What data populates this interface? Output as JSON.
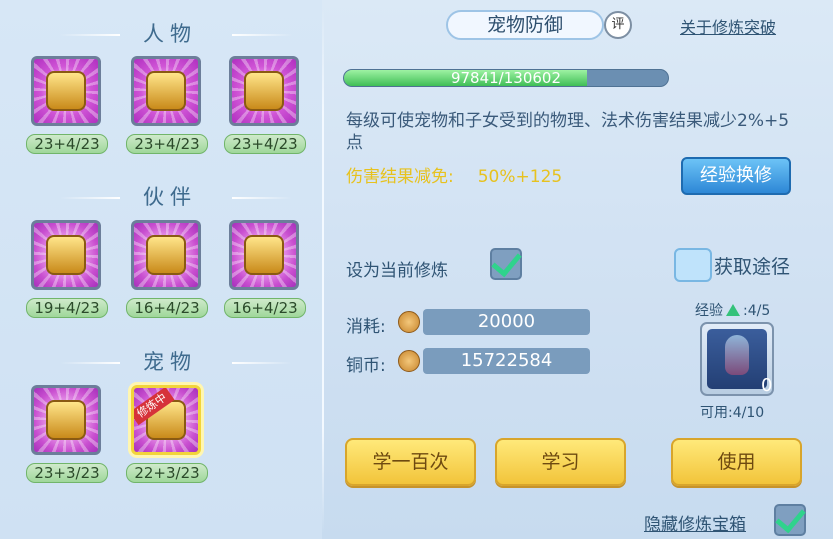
{
  "left_panel": {
    "sections": [
      {
        "title": "人物",
        "items": [
          {
            "label": "23+4/23",
            "icon": "character-icon"
          },
          {
            "label": "23+4/23",
            "icon": "character-shield-icon"
          },
          {
            "label": "23+4/23",
            "icon": "character-armor-icon"
          }
        ]
      },
      {
        "title": "伙伴",
        "items": [
          {
            "label": "19+4/23",
            "icon": "partner-sword-icon"
          },
          {
            "label": "16+4/23",
            "icon": "partner-shield-icon"
          },
          {
            "label": "16+4/23",
            "icon": "partner-hand-icon"
          }
        ]
      },
      {
        "title": "宠物",
        "items": [
          {
            "label": "23+3/23",
            "icon": "pet-sword-icon"
          },
          {
            "label": "22+3/23",
            "icon": "pet-cat-icon",
            "badge": "修炼中",
            "selected": true
          }
        ]
      }
    ]
  },
  "detail": {
    "title": "宠物防御",
    "rating_label": "评",
    "about_link": "关于修炼突破",
    "progress": {
      "text": "97841/130602",
      "current": 97841,
      "max": 130602
    },
    "description": "每级可使宠物和子女受到的物理、法术伤害结果减少2%+5点",
    "reduce_label": "伤害结果减免:",
    "reduce_value": "50%+125",
    "exchange_button": "经验换修",
    "set_current_label": "设为当前修炼",
    "set_current_checked": true,
    "obtain_label": "获取途径",
    "cost_label": "消耗:",
    "cost_value": "20000",
    "coins_label": "铜币:",
    "coins_value": "15722584",
    "exp_label": "经验",
    "exp_value": ":4/5",
    "item_count": "0",
    "available_label": "可用:4/10",
    "buttons": {
      "learn_100": "学一百次",
      "learn": "学习",
      "use": "使用"
    },
    "hide_chest_label": "隐藏修炼宝箱",
    "hide_chest_checked": true
  },
  "colors": {
    "accent_gold": "#f2c43a",
    "accent_blue": "#2d87d6",
    "progress_green": "#3fbe56",
    "reduce_yellow": "#e7c21f"
  }
}
